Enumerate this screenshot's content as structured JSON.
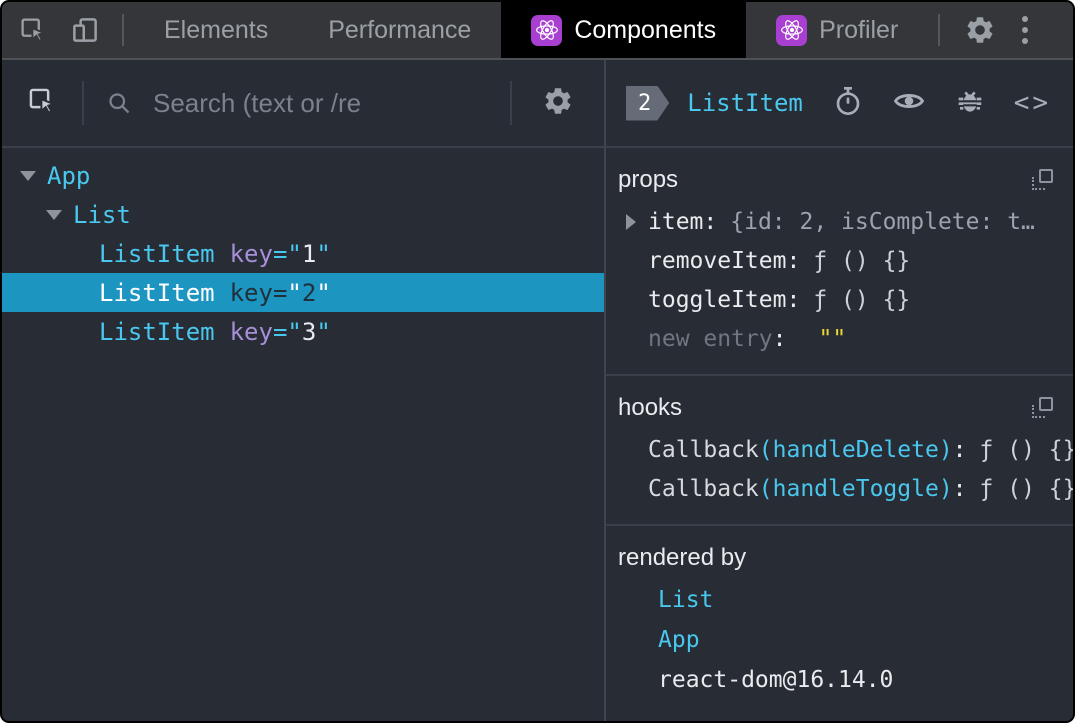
{
  "toolbar": {
    "tabs": [
      {
        "label": "Elements",
        "active": false
      },
      {
        "label": "Performance",
        "active": false
      },
      {
        "label": "Components",
        "active": true,
        "icon": "react-icon"
      },
      {
        "label": "Profiler",
        "active": false,
        "icon": "react-icon"
      }
    ],
    "icons": [
      "inspect-element-icon",
      "device-toolbar-icon",
      "settings-gear-icon",
      "more-menu-icon"
    ]
  },
  "left_panel": {
    "search": {
      "placeholder": "Search (text or /re"
    },
    "icons": [
      "inspect-component-icon",
      "search-icon",
      "settings-gear-icon"
    ],
    "tree": {
      "items": [
        {
          "name": "App",
          "depth": 0,
          "expanded": true
        },
        {
          "name": "List",
          "depth": 1,
          "expanded": true
        },
        {
          "name": "ListItem",
          "depth": 2,
          "attr": {
            "label": "key",
            "value": "1"
          }
        },
        {
          "name": "ListItem",
          "depth": 2,
          "attr": {
            "label": "key",
            "value": "2"
          },
          "selected": true
        },
        {
          "name": "ListItem",
          "depth": 2,
          "attr": {
            "label": "key",
            "value": "3"
          }
        }
      ]
    }
  },
  "right_panel": {
    "header": {
      "badge": "2",
      "component": "ListItem",
      "icons": [
        "stopwatch-icon",
        "eye-icon",
        "bug-icon",
        "view-source-icon"
      ]
    },
    "props": {
      "label": "props",
      "rows": [
        {
          "name": "item",
          "value": "{id: 2, isComplete: t…",
          "expandable": true
        },
        {
          "name": "removeItem",
          "value": "ƒ () {}"
        },
        {
          "name": "toggleItem",
          "value": "ƒ () {}"
        },
        {
          "name": "new entry",
          "value": "\"\"",
          "editable": true
        }
      ]
    },
    "hooks": {
      "label": "hooks",
      "rows": [
        {
          "type": "Callback",
          "name": "handleDelete",
          "value": "ƒ () {}"
        },
        {
          "type": "Callback",
          "name": "handleToggle",
          "value": "ƒ () {}"
        }
      ]
    },
    "rendered_by": {
      "label": "rendered by",
      "items": [
        {
          "name": "List",
          "link": true
        },
        {
          "name": "App",
          "link": true
        },
        {
          "name": "react-dom@16.14.0",
          "link": false
        }
      ]
    }
  },
  "syntax": {
    "eq": "=",
    "quote": "\"",
    "colon": ":",
    "lparen": "(",
    "rparen": ")"
  },
  "colors": {
    "panel_bg": "#282c34",
    "toolbar_bg": "#35363a",
    "tab_active_bg": "#000000",
    "accent_cyan": "#49c7ee",
    "key_purple": "#a78fd9",
    "selected_row_bg": "#1d95c1",
    "react_purple": "#a93fd1",
    "string_yellow": "#e8d637",
    "icon_gray": "#9aa0a6"
  }
}
